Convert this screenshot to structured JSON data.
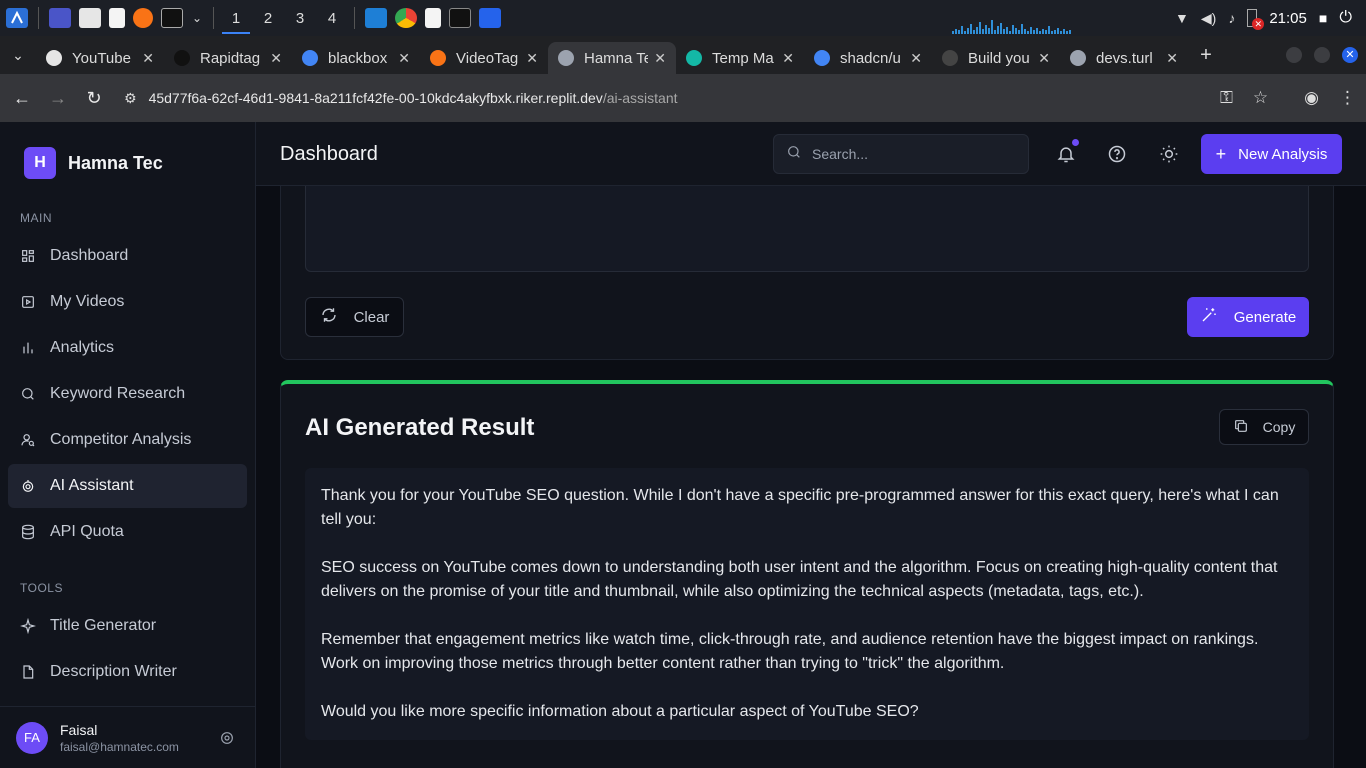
{
  "os": {
    "workspaces": [
      "1",
      "2",
      "3",
      "4"
    ],
    "active_workspace": "1",
    "clock": "21:05",
    "battery_badge": "✕"
  },
  "browser": {
    "tabs": [
      {
        "title": "YouTube",
        "favicon_color": "#e5e5e5"
      },
      {
        "title": "Rapidtag",
        "favicon_color": "#111111"
      },
      {
        "title": "blackbox",
        "favicon_color": "#4285f4"
      },
      {
        "title": "VideoTag",
        "favicon_color": "#f97316"
      },
      {
        "title": "Hamna Te",
        "favicon_color": "#9ca3af"
      },
      {
        "title": "Temp Ma",
        "favicon_color": "#14b8a6"
      },
      {
        "title": "shadcn/u",
        "favicon_color": "#4285f4"
      },
      {
        "title": "Build you",
        "favicon_color": "#444444"
      },
      {
        "title": "devs.turl",
        "favicon_color": "#9ca3af"
      }
    ],
    "active_tab_index": 4,
    "new_tab": "+",
    "url_host": "45d77f6a-62cf-46d1-9841-8a211fcf42fe-00-10kdc4akyfbxk.riker.replit.dev",
    "url_path": "/ai-assistant"
  },
  "brand": {
    "logo_letter": "H",
    "name": "Hamna Tec"
  },
  "sidebar": {
    "main_label": "MAIN",
    "main_items": [
      {
        "label": "Dashboard",
        "icon": "dashboard-icon"
      },
      {
        "label": "My Videos",
        "icon": "video-icon"
      },
      {
        "label": "Analytics",
        "icon": "analytics-icon"
      },
      {
        "label": "Keyword Research",
        "icon": "search-icon"
      },
      {
        "label": "Competitor Analysis",
        "icon": "user-search-icon"
      },
      {
        "label": "AI Assistant",
        "icon": "bot-icon",
        "active": true
      },
      {
        "label": "API Quota",
        "icon": "database-icon"
      }
    ],
    "tools_label": "TOOLS",
    "tool_items": [
      {
        "label": "Title Generator",
        "icon": "sparkle-icon"
      },
      {
        "label": "Description Writer",
        "icon": "document-icon"
      }
    ]
  },
  "user": {
    "initials": "FA",
    "name": "Faisal",
    "email": "faisal@hamnatec.com"
  },
  "header": {
    "title": "Dashboard",
    "search_placeholder": "Search...",
    "new_button": "New Analysis"
  },
  "prompt_card": {
    "clear_label": "Clear",
    "generate_label": "Generate"
  },
  "result": {
    "title": "AI Generated Result",
    "copy_label": "Copy",
    "accent_color": "#22c55e",
    "paragraphs": [
      "Thank you for your YouTube SEO question. While I don't have a specific pre-programmed answer for this exact query, here's what I can tell you:",
      "SEO success on YouTube comes down to understanding both user intent and the algorithm. Focus on creating high-quality content that delivers on the promise of your title and thumbnail, while also optimizing the technical aspects (metadata, tags, etc.).",
      "Remember that engagement metrics like watch time, click-through rate, and audience retention have the biggest impact on rankings. Work on improving those metrics through better content rather than trying to \"trick\" the algorithm.",
      "Would you like more specific information about a particular aspect of YouTube SEO?"
    ]
  },
  "colors": {
    "accent": "#5b3ef0",
    "brand": "#6d4cf6",
    "background": "#0b0d14",
    "panel": "#11141c"
  }
}
